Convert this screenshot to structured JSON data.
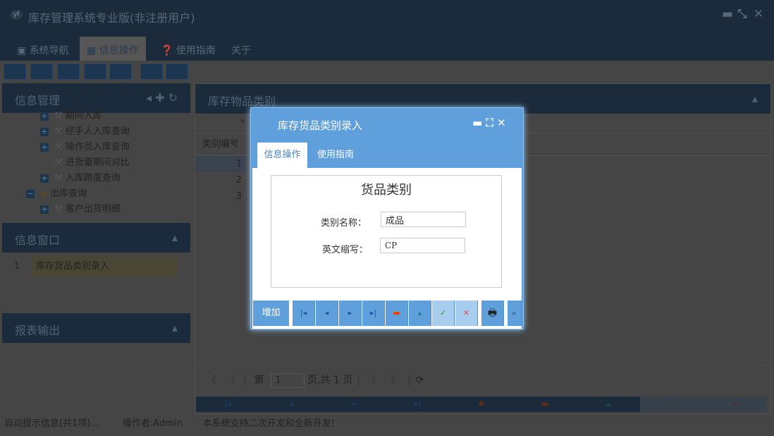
{
  "app": {
    "title": "库存管理系统专业版(非注册用户)",
    "logo": "yf"
  },
  "main_tabs": [
    {
      "label": "系统导航"
    },
    {
      "label": "信息操作"
    },
    {
      "label": "使用指南"
    },
    {
      "label": "关于"
    }
  ],
  "left": {
    "info_mgmt": "信息管理",
    "tree": [
      "期间入库",
      "经手人入库查询",
      "操作员入库查询",
      "进货量期间对比",
      "入库跨度查询",
      "出库查询",
      "客户出货明细"
    ],
    "info_window": "信息窗口",
    "window_items": [
      {
        "num": "1",
        "label": "库存货品类别录入"
      }
    ],
    "report": "报表输出"
  },
  "right": {
    "title": "库存物品类别",
    "col_header": "类别编号",
    "rows": [
      "1",
      "2",
      "3"
    ],
    "pager": {
      "prefix": "第",
      "page": "1",
      "suffix": "页,共 1 页"
    }
  },
  "dialog": {
    "title": "库存货品类别录入",
    "tabs": [
      "信息操作",
      "使用指南"
    ],
    "legend": "货品类别",
    "fields": [
      {
        "label": "类别名称：",
        "value": "成品"
      },
      {
        "label": "英文缩写：",
        "value": "CP"
      }
    ],
    "add_label": "增加"
  },
  "status": {
    "hint": "自动提示信息(共1项)...",
    "operator": "操作者:Admin",
    "notice": "本系统支持二次开发和全新开发!"
  }
}
